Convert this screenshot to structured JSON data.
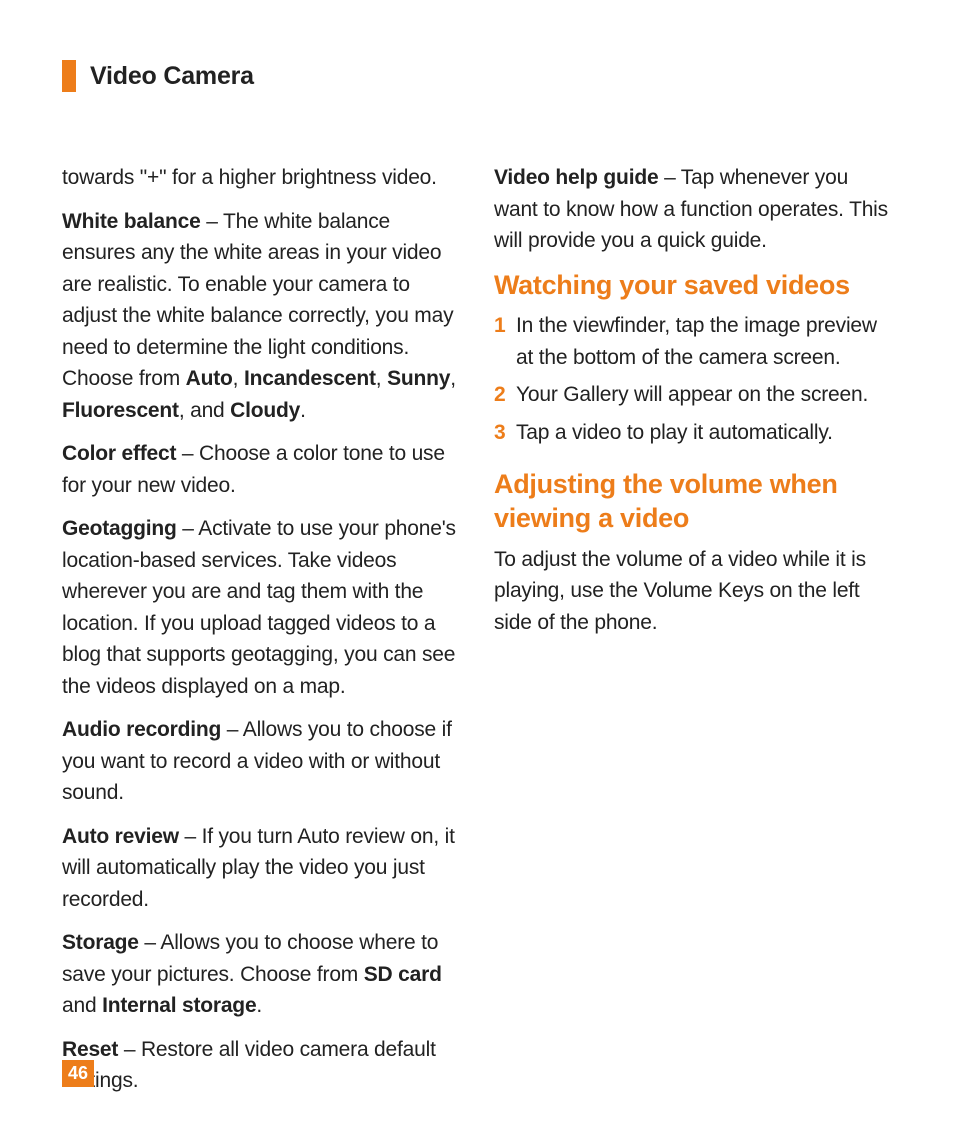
{
  "header": {
    "title": "Video Camera"
  },
  "pageNumber": "46",
  "left": {
    "intro": "towards \"+\" for a higher brightness video.",
    "wb_label": "White balance",
    "wb_text1": " – The white balance ensures any the white areas in your video are realistic. To enable your camera to adjust the white balance correctly, you may need to determine the light conditions. Choose from ",
    "wb_auto": "Auto",
    "wb_sep1": ", ",
    "wb_inc": "Incandescent",
    "wb_sep2": ", ",
    "wb_sunny": "Sunny",
    "wb_sep3": ", ",
    "wb_fluo": "Fluorescent",
    "wb_sep4": ", and ",
    "wb_cloudy": "Cloudy",
    "wb_end": ".",
    "ce_label": "Color effect",
    "ce_text": " – Choose a color tone to use for your new video.",
    "geo_label": "Geotagging",
    "geo_text": " – Activate to use your phone's location-based services. Take videos wherever you are and tag them with the location. If you upload tagged videos to a blog that supports geotagging, you can see the videos displayed on a map.",
    "ar_label": "Audio recording",
    "ar_text": " – Allows you to choose if you want to record a video with or without sound.",
    "rev_label": "Auto review",
    "rev_text": " – If you turn Auto review on, it will automatically play the video you just recorded.",
    "st_label": "Storage",
    "st_text1": " – Allows you to choose where to save your pictures. Choose from ",
    "st_sd": "SD card",
    "st_and": " and ",
    "st_int": "Internal storage",
    "st_end": ".",
    "rs_label": "Reset",
    "rs_text": " – Restore all video camera default settings."
  },
  "right": {
    "vh_label": "Video help guide",
    "vh_text": " – Tap whenever you want to know how a function operates. This will provide you a quick guide.",
    "h_watch": "Watching your saved videos",
    "step1_n": "1",
    "step1": "In the viewfinder, tap the image preview at the bottom of the camera screen.",
    "step2_n": "2",
    "step2": "Your Gallery will appear on the screen.",
    "step3_n": "3",
    "step3": "Tap a video to play it automatically.",
    "h_adjust": "Adjusting the volume when viewing a video",
    "adjust_text": "To adjust the volume of a video while it is playing, use the Volume Keys on the left side of the phone."
  }
}
